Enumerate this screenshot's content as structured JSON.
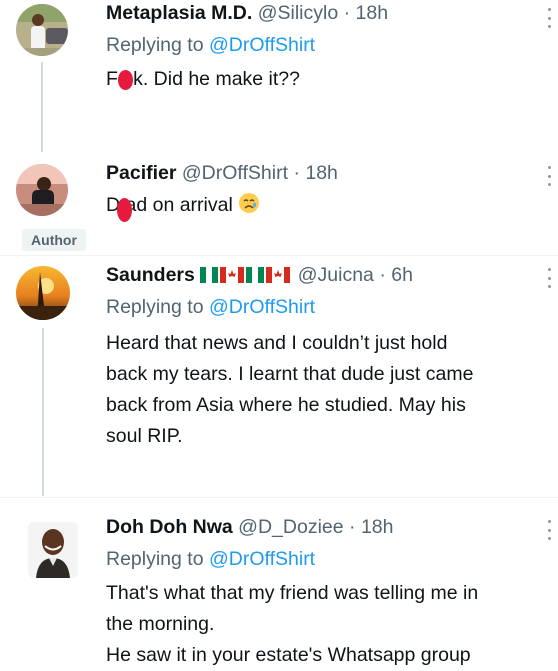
{
  "tweets": [
    {
      "name": "Metaplasia M.D.",
      "handle": "@Silicylo",
      "time": "18h",
      "replying_prefix": "Replying to",
      "replying_to": "@DrOffShirt",
      "text": "F ck. Did he make it??"
    },
    {
      "name": "Pacifier",
      "handle": "@DrOffShirt",
      "time": "18h",
      "author_badge": "Author",
      "text": "D ad on arrival",
      "emoji": "sad-face-emoji"
    },
    {
      "name": "Saunders",
      "handle": "@Juicna",
      "time": "6h",
      "flags": [
        "nigeria-flag",
        "canada-flag",
        "nigeria-flag",
        "canada-flag"
      ],
      "replying_prefix": "Replying to",
      "replying_to": "@DrOffShirt",
      "lines": [
        "Heard that news and I couldn’t just hold",
        "back my tears. I learnt that dude just came",
        "back from Asia where he studied. May his",
        "soul RIP."
      ]
    },
    {
      "name": "Doh Doh Nwa",
      "handle": "@D_Doziee",
      "time": "18h",
      "replying_prefix": "Replying to",
      "replying_to": "@DrOffShirt",
      "lines": [
        "That's what that my friend was telling me in",
        "the morning.",
        "He saw it in your estate's Whatsapp group"
      ]
    }
  ],
  "separator": "·",
  "colors": {
    "link": "#1d9bf0",
    "secondary": "#536471",
    "censor": "#e61a3c"
  }
}
